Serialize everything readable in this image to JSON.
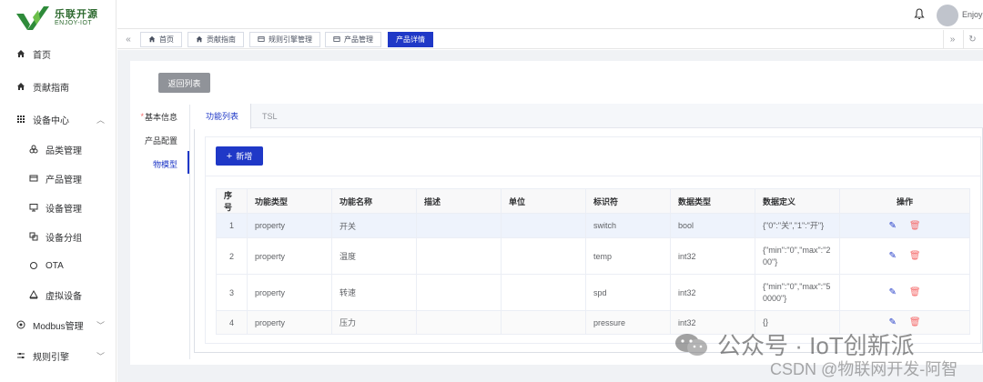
{
  "brand": {
    "title": "乐联开源",
    "subtitle": "ENJOY-IOT"
  },
  "sidebar": {
    "items": [
      {
        "label": "首页",
        "icon": "home-icon"
      },
      {
        "label": "贡献指南",
        "icon": "home-icon"
      },
      {
        "label": "设备中心",
        "icon": "grid-icon",
        "expanded": true
      },
      {
        "label": "品类管理",
        "icon": "category-icon"
      },
      {
        "label": "产品管理",
        "icon": "product-icon"
      },
      {
        "label": "设备管理",
        "icon": "monitor-icon"
      },
      {
        "label": "设备分组",
        "icon": "group-icon"
      },
      {
        "label": "OTA",
        "icon": "circle-icon"
      },
      {
        "label": "虚拟设备",
        "icon": "virtual-icon"
      },
      {
        "label": "Modbus管理",
        "icon": "modbus-icon"
      },
      {
        "label": "规则引擎",
        "icon": "rule-icon"
      }
    ]
  },
  "topbar": {
    "user_name": "Enjoy"
  },
  "tabs": [
    {
      "label": "首页",
      "icon": "home-icon"
    },
    {
      "label": "贡献指南",
      "icon": "home-icon"
    },
    {
      "label": "规则引擎管理",
      "icon": "list-icon"
    },
    {
      "label": "产品管理",
      "icon": "list-icon"
    },
    {
      "label": "产品详情",
      "active": true
    }
  ],
  "main": {
    "back_label": "返回列表",
    "vtabs": [
      {
        "label": "基本信息",
        "required_mark": "*"
      },
      {
        "label": "产品配置"
      },
      {
        "label": "物模型",
        "active": true
      }
    ],
    "htabs": [
      {
        "label": "功能列表",
        "active": true
      },
      {
        "label": "TSL"
      }
    ],
    "add_label": "新增",
    "add_icon": "+",
    "table": {
      "headers": [
        "序号",
        "功能类型",
        "功能名称",
        "描述",
        "单位",
        "标识符",
        "数据类型",
        "数据定义",
        "操作"
      ],
      "rows": [
        [
          "1",
          "property",
          "开关",
          "",
          "",
          "switch",
          "bool",
          "{\"0\":\"关\",\"1\":\"开\"}"
        ],
        [
          "2",
          "property",
          "温度",
          "",
          "",
          "temp",
          "int32",
          "{\"min\":\"0\",\"max\":\"200\"}"
        ],
        [
          "3",
          "property",
          "转速",
          "",
          "",
          "spd",
          "int32",
          "{\"min\":\"0\",\"max\":\"50000\"}"
        ],
        [
          "4",
          "property",
          "压力",
          "",
          "",
          "pressure",
          "int32",
          "{}"
        ]
      ]
    }
  },
  "watermark": {
    "line1": "公众号 · IoT创新派",
    "line2": "CSDN @物联网开发-阿智"
  },
  "colors": {
    "accent": "#1f38c7",
    "danger": "#f56c6c",
    "brand_green": "#2d6a2f"
  }
}
